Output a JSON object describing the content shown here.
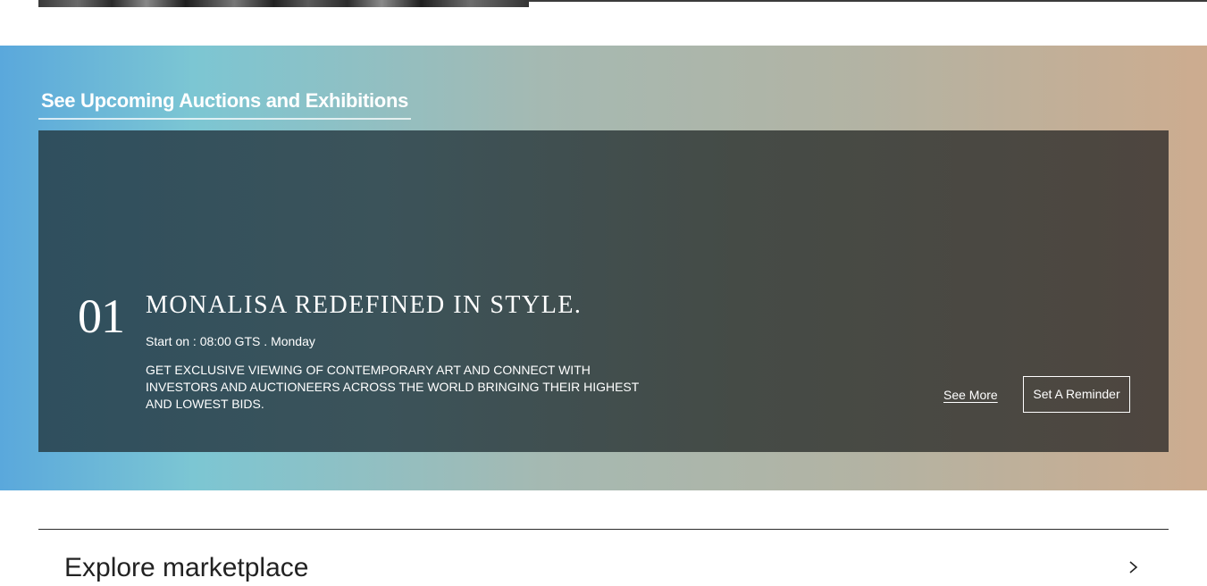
{
  "header": {
    "top_image_icon": "gallery-image"
  },
  "auctions": {
    "section_title": "See Upcoming Auctions and Exhibitions",
    "items": [
      {
        "number": "01",
        "title": "MONALISA REDEFINED IN STYLE.",
        "start": "Start on : 08:00 GTS . Monday",
        "description": "GET EXCLUSIVE VIEWING OF CONTEMPORARY ART AND CONNECT WITH INVESTORS AND AUCTIONEERS ACROSS THE WORLD BRINGING THEIR HIGHEST AND LOWEST BIDS.",
        "see_more_label": "See More",
        "reminder_label": "Set A Reminder"
      }
    ],
    "colors": {
      "band_start": "#5aa8dc",
      "band_mid": "#7cc6d3",
      "band_end": "#cdac8f",
      "card_start": "#2f4f5e",
      "card_end": "#4e463f"
    }
  },
  "marketplace": {
    "title": "Explore marketplace",
    "chevron_icon": "chevron-right-icon"
  }
}
